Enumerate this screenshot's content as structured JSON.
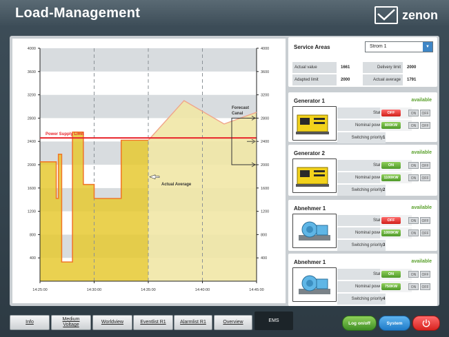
{
  "header": {
    "title": "Load-Management",
    "brand": "zenon"
  },
  "chart_data": {
    "type": "area",
    "x_ticks": [
      "14:25:00",
      "14:30:00",
      "14:35:00",
      "14:40:00",
      "14:45:00"
    ],
    "y_ticks": [
      "400",
      "800",
      "1200",
      "1600",
      "2000",
      "2400",
      "2800",
      "3200",
      "3600",
      "4000"
    ],
    "ylim": [
      0,
      4000
    ],
    "xlim": [
      0,
      20
    ],
    "actual_average_label": "Actual Average",
    "power_supply_limit_label": "Power Supply Limit",
    "forecast_label_line1": "Forecast",
    "forecast_label_line2": "Canal",
    "power_supply_limit": 2460,
    "actual_series": {
      "x": [
        0,
        1.5,
        1.5,
        1.7,
        1.7,
        2.0,
        2.0,
        3.0,
        3.0,
        3.1,
        3.1,
        4.0,
        4.0,
        5.0,
        5.0,
        7.5,
        7.5,
        10.0,
        10.0
      ],
      "y": [
        2050,
        2050,
        1420,
        1420,
        2180,
        2180,
        330,
        330,
        2560,
        2560,
        2560,
        2560,
        1660,
        1660,
        1420,
        1420,
        2420,
        2420,
        2420
      ]
    },
    "forecast_series": {
      "x": [
        10.0,
        13.3,
        17.0,
        20.0
      ],
      "y": [
        2420,
        3100,
        2700,
        2900
      ]
    }
  },
  "service_areas": {
    "title": "Service Areas",
    "selected": "Strom 1",
    "actual_value_label": "Actual value",
    "actual_value": "1661",
    "delivery_limit_label": "Delivery limit",
    "delivery_limit": "2000",
    "adapted_limit_label": "Adapted limit",
    "adapted_limit": "2000",
    "actual_average_label": "Actual average",
    "actual_average": "1791"
  },
  "labels": {
    "state": "State",
    "nominal_power": "Nominal power",
    "switching_priority": "Switching priority",
    "on": "ON",
    "off": "OFF",
    "available": "available"
  },
  "units": [
    {
      "title": "Generator 1",
      "status": "available",
      "state": "OFF",
      "power": "800KW",
      "priority": "1"
    },
    {
      "title": "Generator 2",
      "status": "available",
      "state": "ON",
      "power": "1100KW",
      "priority": "2"
    },
    {
      "title": "Abnehmer 1",
      "status": "available",
      "state": "OFF",
      "power": "1000KW",
      "priority": "3"
    },
    {
      "title": "Abnehmer 1",
      "status": "available",
      "state": "ON",
      "power": "750KW",
      "priority": "4"
    }
  ],
  "nav": {
    "info": "Info",
    "medium_voltage_1": "Medium",
    "medium_voltage_2": "Voltage",
    "worldview": "Worldview",
    "eventlist": "Eventlist R1",
    "alarmlist": "Alarmlist R1",
    "overview": "Overview",
    "ems": "EMS",
    "logon": "Log on/off",
    "system": "System"
  },
  "colors": {
    "state_on": "#5aa02c",
    "state_off": "#d0201a",
    "limit_line": "#e8232a",
    "actual_fill": "#e6c931",
    "actual_stroke": "#f0782a",
    "forecast_fill": "#f1e7a6"
  }
}
